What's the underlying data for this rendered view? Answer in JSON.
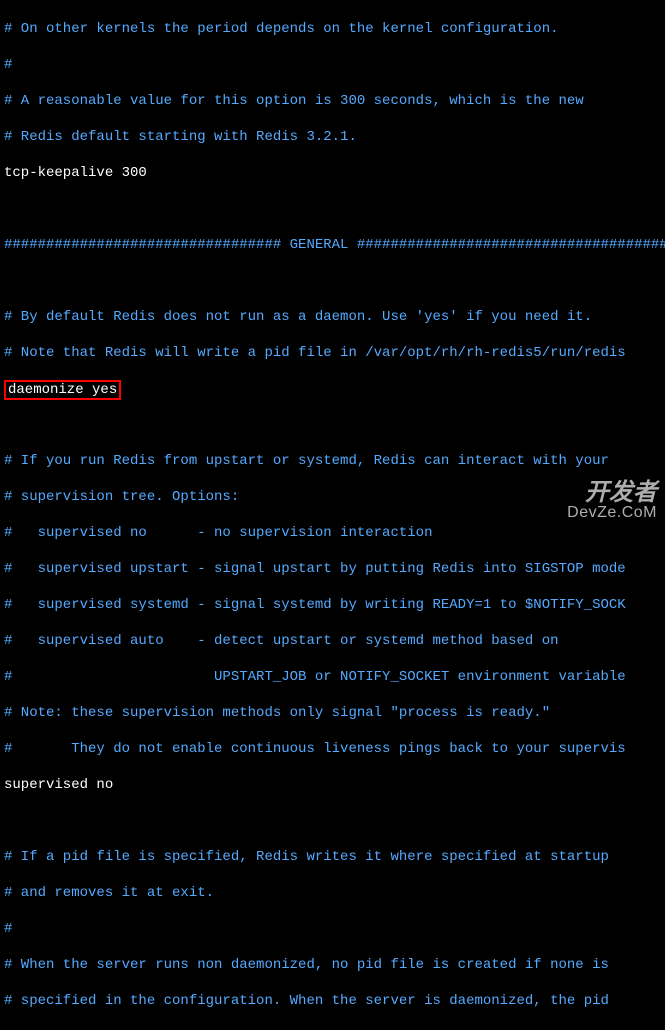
{
  "lines": {
    "l1": "# On other kernels the period depends on the kernel configuration.",
    "l2": "#",
    "l3": "# A reasonable value for this option is 300 seconds, which is the new",
    "l4": "# Redis default starting with Redis 3.2.1.",
    "l5": "tcp-keepalive 300",
    "l6": "",
    "l7": "################################# GENERAL #####################################",
    "l8": "",
    "l9": "# By default Redis does not run as a daemon. Use 'yes' if you need it.",
    "l10": "# Note that Redis will write a pid file in /var/opt/rh/rh-redis5/run/redis",
    "l11": "daemonize yes",
    "l12": "",
    "l13": "# If you run Redis from upstart or systemd, Redis can interact with your",
    "l14": "# supervision tree. Options:",
    "l15": "#   supervised no      - no supervision interaction",
    "l16": "#   supervised upstart - signal upstart by putting Redis into SIGSTOP mode",
    "l17": "#   supervised systemd - signal systemd by writing READY=1 to $NOTIFY_SOCK",
    "l18": "#   supervised auto    - detect upstart or systemd method based on",
    "l19": "#                        UPSTART_JOB or NOTIFY_SOCKET environment variable",
    "l20": "# Note: these supervision methods only signal \"process is ready.\"",
    "l21": "#       They do not enable continuous liveness pings back to your supervis",
    "l22": "supervised no",
    "l23": "",
    "l24": "# If a pid file is specified, Redis writes it where specified at startup",
    "l25": "# and removes it at exit.",
    "l26": "#",
    "l27": "# When the server runs non daemonized, no pid file is created if none is",
    "l28": "# specified in the configuration. When the server is daemonized, the pid "
  },
  "watermark": {
    "top": "开发者",
    "bottom": "DevZe.CoM"
  }
}
